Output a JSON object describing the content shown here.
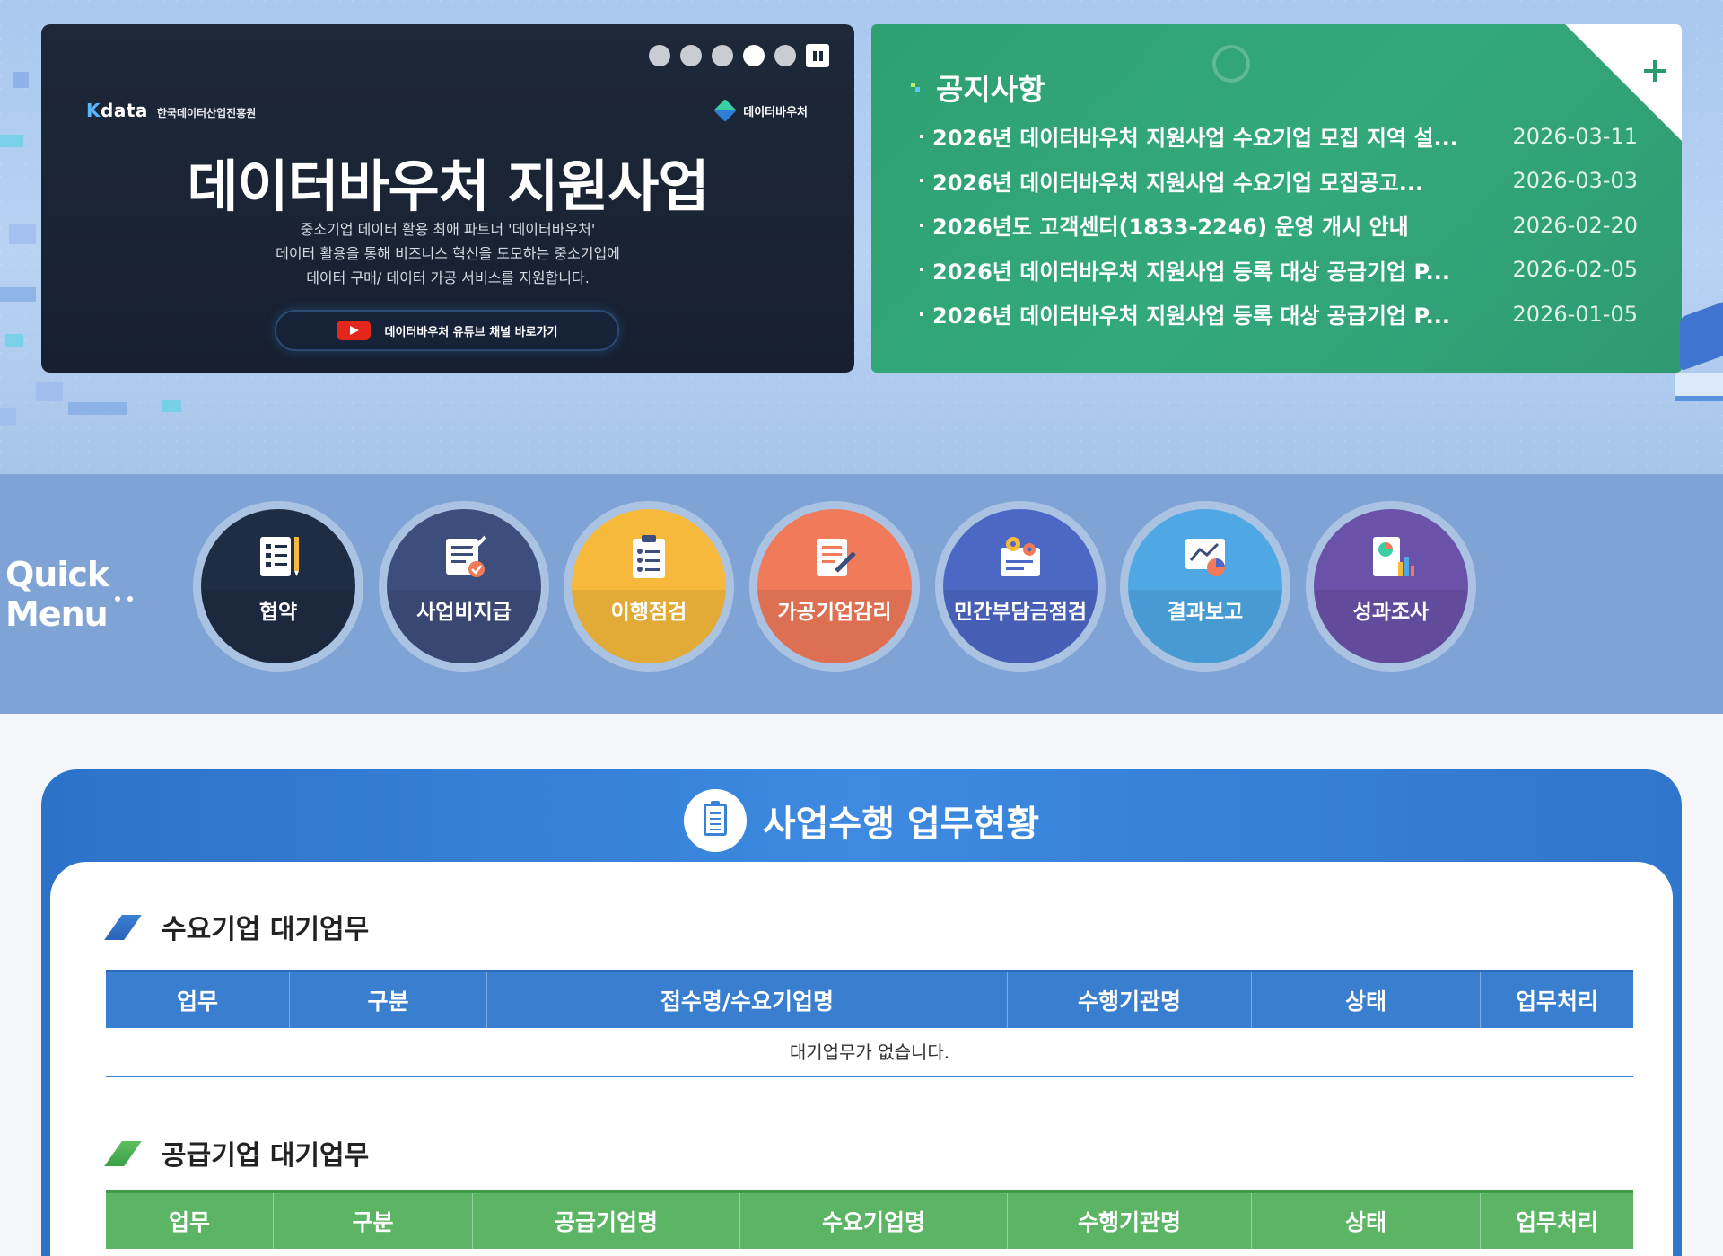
{
  "banner": {
    "org_mark": "data",
    "org_mark_prefix": "K",
    "org_name": "한국데이터산업진흥원",
    "brand": "데이터바우처",
    "title": "데이터바우처 지원사업",
    "desc_1": "중소기업 데이터 활용 최애 파트너 '데이터바우처'",
    "desc_2": "데이터 활용을 통해 비즈니스 혁신을 도모하는 중소기업에",
    "desc_3": "데이터 구매/ 데이터 가공 서비스를 지원합니다.",
    "youtube_label": "데이터바우처 유튜브 채널 바로가기",
    "slides": 5,
    "active_slide": 4
  },
  "notice": {
    "title": "공지사항",
    "items": [
      {
        "title": "2026년 데이터바우처 지원사업 수요기업 모집 지역 설...",
        "date": "2026-03-11"
      },
      {
        "title": "2026년 데이터바우처 지원사업 수요기업 모집공고...",
        "date": "2026-03-03"
      },
      {
        "title": "2026년도 고객센터(1833-2246) 운영 개시 안내",
        "date": "2026-02-20"
      },
      {
        "title": "2026년 데이터바우처 지원사업 등록 대상 공급기업 P...",
        "date": "2026-02-05"
      },
      {
        "title": "2026년 데이터바우처 지원사업 등록 대상 공급기업 P...",
        "date": "2026-01-05"
      }
    ]
  },
  "quick_menu": {
    "label_1": "Quick",
    "label_2": "Menu",
    "items": [
      {
        "label": "협약",
        "color": "#1e2c44",
        "icon": "contract-icon"
      },
      {
        "label": "사업비지급",
        "color": "#3e4e7c",
        "icon": "payment-icon"
      },
      {
        "label": "이행점검",
        "color": "#f6b93b",
        "icon": "checklist-icon"
      },
      {
        "label": "가공기업감리",
        "color": "#f07a5a",
        "icon": "audit-icon"
      },
      {
        "label": "민간부담금점검",
        "color": "#4c68c4",
        "icon": "settings-icon"
      },
      {
        "label": "결과보고",
        "color": "#4fa8e4",
        "icon": "report-icon"
      },
      {
        "label": "성과조사",
        "color": "#6a52a8",
        "icon": "survey-icon"
      }
    ]
  },
  "work": {
    "title": "사업수행 업무현황",
    "demand": {
      "title": "수요기업 대기업무",
      "headers": [
        "업무",
        "구분",
        "접수명/수요기업명",
        "수행기관명",
        "상태",
        "업무처리"
      ],
      "empty": "대기업무가 없습니다."
    },
    "supply": {
      "title": "공급기업 대기업무",
      "headers": [
        "업무",
        "구분",
        "공급기업명",
        "수요기업명",
        "수행기관명",
        "상태",
        "업무처리"
      ]
    }
  }
}
